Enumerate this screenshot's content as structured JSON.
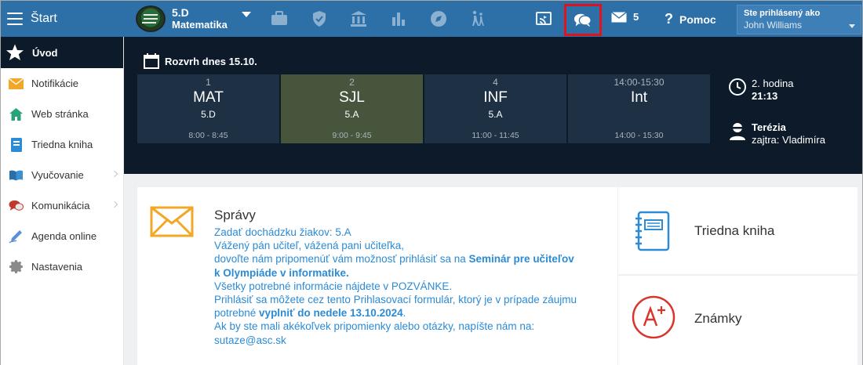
{
  "topbar": {
    "start_label": "Štart",
    "class_line1": "5.D",
    "class_line2": "Matematika",
    "mail_count": "5",
    "help_label": "Pomoc",
    "user_label": "Ste prihlásený ako",
    "user_name": "John Williams",
    "accent_color": "#2d70a8",
    "highlight_color": "#e0121b",
    "nav_icons": [
      "briefcase-icon",
      "shield-icon",
      "bank-icon",
      "bar-chart-icon",
      "compass-icon",
      "walking-icon",
      "cast-icon",
      "chat-icon",
      "mail-icon",
      "help-icon"
    ]
  },
  "sidebar": {
    "head_label": "Úvod",
    "items": [
      {
        "label": "Notifikácie",
        "icon": "envelope-icon",
        "has_arrow": false
      },
      {
        "label": "Web stránka",
        "icon": "home-icon",
        "has_arrow": false
      },
      {
        "label": "Triedna kniha",
        "icon": "book-icon",
        "has_arrow": false
      },
      {
        "label": "Vyučovanie",
        "icon": "open-book-icon",
        "has_arrow": true
      },
      {
        "label": "Komunikácia",
        "icon": "speech-bubbles-icon",
        "has_arrow": true
      },
      {
        "label": "Agenda online",
        "icon": "pen-icon",
        "has_arrow": false
      },
      {
        "label": "Nastavenia",
        "icon": "gear-icon",
        "has_arrow": false
      }
    ]
  },
  "schedule": {
    "title": "Rozvrh dnes 15.10.",
    "lessons": [
      {
        "num": "1",
        "subject": "MAT",
        "class": "5.D",
        "time": "8:00 - 8:45"
      },
      {
        "num": "2",
        "subject": "SJL",
        "class": "5.A",
        "time": "9:00 - 9:45"
      },
      {
        "num": "4",
        "subject": "INF",
        "class": "5.A",
        "time": "11:00 - 11:45"
      },
      {
        "num": "14:00-15:30",
        "subject": "Int",
        "class": "",
        "time": "14:00 - 15:30"
      }
    ],
    "current_period": "2. hodina",
    "current_time": "21:13",
    "duty_name": "Terézia",
    "duty_tomorrow": "zajtra: Vladimíra"
  },
  "messages": {
    "title": "Správy",
    "line1": "Zadať dochádzku žiakov: 5.A",
    "line2": "Vážený pán učiteľ, vážená pani učiteľka,",
    "line3a": "dovoľte nám pripomenúť vám možnosť prihlásiť sa na ",
    "line3b": "Seminár pre učiteľov k Olympiáde v informatike.",
    "line4": "Všetky potrebné informácie nájdete v POZVÁNKE.",
    "line5a": "Prihlásiť sa môžete cez tento Prihlasovací formulár, ktorý je v prípade záujmu potrebné ",
    "line5b": "vyplniť do nedele 13.10.2024",
    "line5c": ".",
    "line6": "Ak by ste mali akékoľvek pripomienky alebo otázky, napíšte nám na:",
    "line7": "sutaze@asc.sk"
  },
  "cards": {
    "triedna_kniha": "Triedna kniha",
    "znamky": "Známky"
  }
}
